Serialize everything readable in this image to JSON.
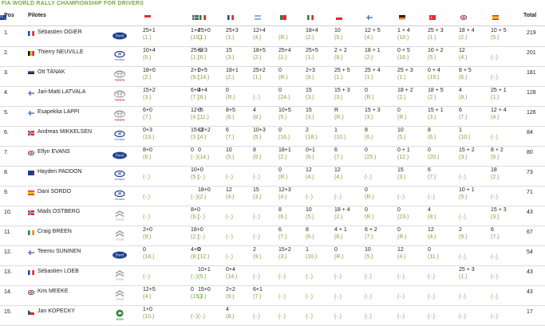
{
  "title": "FIA WORLD RALLY CHAMPIONSHIP FOR DRIVERS",
  "header": {
    "pos": "Pos",
    "pilotes": "Pilotes",
    "total": "Total"
  },
  "rally_flags": [
    {
      "flag": "monaco",
      "colors": [
        "#e8262c",
        "#ffffff"
      ]
    },
    {
      "flag": "sweden",
      "colors": [
        "#2f5ea8",
        "#f3c418"
      ]
    },
    {
      "flag": "mexico",
      "colors": [
        "#1b8a3c",
        "#ffffff",
        "#d52b1e"
      ]
    },
    {
      "flag": "france",
      "colors": [
        "#1e4ea0",
        "#ffffff",
        "#e8262c"
      ]
    },
    {
      "flag": "argentina",
      "colors": [
        "#7fb7e6",
        "#ffffff",
        "#7fb7e6"
      ]
    },
    {
      "flag": "portugal",
      "colors": [
        "#1b8a3c",
        "#e8262c"
      ]
    },
    {
      "flag": "italy",
      "colors": [
        "#1b8a3c",
        "#ffffff",
        "#e8262c"
      ]
    },
    {
      "flag": "poland",
      "colors": [
        "#ffffff",
        "#e8262c"
      ]
    },
    {
      "flag": "finland",
      "colors": [
        "#ffffff",
        "#2f5ea8"
      ]
    },
    {
      "flag": "germany",
      "colors": [
        "#111111",
        "#e8262c",
        "#f3c418"
      ]
    },
    {
      "flag": "turkey",
      "colors": [
        "#e8262c",
        "#ffffff"
      ]
    },
    {
      "flag": "great-britain",
      "colors": [
        "#1e3e8a",
        "#ffffff",
        "#e8262c"
      ]
    },
    {
      "flag": "spain",
      "colors": [
        "#e8262c",
        "#f3c418",
        "#e8262c"
      ]
    },
    {
      "flag": "australia",
      "colors": [
        "#1e3e8a",
        "#ffffff"
      ]
    }
  ],
  "drivers": [
    {
      "pos": "1.",
      "name": "Sébastien OGIER",
      "flag": "france",
      "team": "ford",
      "total": "219",
      "results": [
        [
          "25+1",
          "(1.)"
        ],
        [
          "1+4",
          "(10.)"
        ],
        [
          "25+0",
          "(1.)"
        ],
        [
          "25+3",
          "(1.)"
        ],
        [
          "12+4",
          "(4.)"
        ],
        [
          "",
          "(R.)"
        ],
        [
          "18+4",
          "(2.)"
        ],
        [
          "10",
          "(5.)"
        ],
        [
          "12 + 5",
          "(4.)"
        ],
        [
          "1 + 4",
          "(10.)"
        ],
        [
          "25 + 3",
          "(1.)"
        ],
        [
          "18 + 4",
          "(2.)"
        ],
        [
          "10 + 5",
          "(5.)"
        ],
        [
          "",
          ""
        ]
      ]
    },
    {
      "pos": "2.",
      "name": "Thierry NEUVILLE",
      "flag": "belgium",
      "team": "hyundai",
      "total": "201",
      "results": [
        [
          "10+4",
          "(5.)"
        ],
        [
          "25+2",
          "(1.)"
        ],
        [
          "8+3",
          "(6.)"
        ],
        [
          "15",
          "(3.)"
        ],
        [
          "18+5",
          "(2.)"
        ],
        [
          "25+4",
          "(1.)"
        ],
        [
          "25+5",
          "(1.)"
        ],
        [
          "2 + 2",
          "(9.)"
        ],
        [
          "18 + 1",
          "(2.)"
        ],
        [
          "0 + 5",
          "(16.)"
        ],
        [
          "10 + 2",
          "(5.)"
        ],
        [
          "12",
          "(4.)"
        ],
        [
          "",
          "(-.)"
        ],
        [
          "",
          ""
        ]
      ]
    },
    {
      "pos": "3.",
      "name": "Ott TÄNAK",
      "flag": "estonia",
      "team": "toyota",
      "total": "181",
      "results": [
        [
          "18+0",
          "(2.)"
        ],
        [
          "2+1",
          "(9.)"
        ],
        [
          "0+5",
          "(14.)"
        ],
        [
          "18+1",
          "(2.)"
        ],
        [
          "25+2",
          "(1.)"
        ],
        [
          "0",
          "(R.)"
        ],
        [
          "2+3",
          "(9.)"
        ],
        [
          "25 + 5",
          "(1.)"
        ],
        [
          "25 + 4",
          "(1.)"
        ],
        [
          "25 + 3",
          "(1.)"
        ],
        [
          "0 + 4",
          "(19.)"
        ],
        [
          "8 + 5",
          "(6.)"
        ],
        [
          "",
          "(-.)"
        ],
        [
          "",
          ""
        ]
      ]
    },
    {
      "pos": "4.",
      "name": "Jari-Matti LATVALA",
      "flag": "finland",
      "team": "toyota",
      "total": "128",
      "results": [
        [
          "15+2",
          "(3.)"
        ],
        [
          "6+0",
          "(7.)"
        ],
        [
          "4+4",
          "(8.)"
        ],
        [
          "0",
          "(R.)"
        ],
        [
          "",
          "(-.)"
        ],
        [
          "0",
          "(24.)"
        ],
        [
          "15",
          "(3.)"
        ],
        [
          "15 + 3",
          "(3.)"
        ],
        [
          "0",
          "(R.)"
        ],
        [
          "18 + 2",
          "(2.)"
        ],
        [
          "18 + 5",
          "(2.)"
        ],
        [
          "4",
          "(8.)"
        ],
        [
          "25 + 1",
          "(1.)"
        ],
        [
          "",
          ""
        ]
      ]
    },
    {
      "pos": "5.",
      "name": "Esapekka LAPPI",
      "flag": "finland",
      "team": "toyota",
      "total": "126",
      "results": [
        [
          "6+0",
          "(7.)"
        ],
        [
          "12+5",
          "(4.)"
        ],
        [
          "0",
          "(11.)"
        ],
        [
          "8+5",
          "(6.)"
        ],
        [
          "4",
          "(8.)"
        ],
        [
          "10+5",
          "(5.)"
        ],
        [
          "15",
          "(3.)"
        ],
        [
          "R",
          "(R.)"
        ],
        [
          "15 + 3",
          "(3.)"
        ],
        [
          "0",
          "(R.)"
        ],
        [
          "15 + 1",
          "(3.)"
        ],
        [
          "6",
          "(7.)"
        ],
        [
          "12 + 4",
          "(4.)"
        ],
        [
          "",
          ""
        ]
      ]
    },
    {
      "pos": "6.",
      "name": "Andreas MIKKELSEN",
      "flag": "norway",
      "team": "hyundai",
      "total": "84",
      "results": [
        [
          "0+3",
          "(13.)"
        ],
        [
          "15+3",
          "(3.)"
        ],
        [
          "12+2",
          "(4.)"
        ],
        [
          "6",
          "(7.)"
        ],
        [
          "10+3",
          "(5.)"
        ],
        [
          "0",
          "(16.)"
        ],
        [
          "2",
          "(18.)"
        ],
        [
          "1",
          "(10.)"
        ],
        [
          "8",
          "(6.)"
        ],
        [
          "10",
          "(5.)"
        ],
        [
          "8",
          "(6.)"
        ],
        [
          "1",
          "(10.)"
        ],
        [
          "",
          "(-.)"
        ],
        [
          "",
          ""
        ]
      ]
    },
    {
      "pos": "7.",
      "name": "Elfyn EVANS",
      "flag": "great-britain",
      "team": "ford",
      "total": "80",
      "results": [
        [
          "8+0",
          "(6.)"
        ],
        [
          "0",
          "(-.)"
        ],
        [
          "0",
          "(14.)"
        ],
        [
          "10",
          "(5.)"
        ],
        [
          "8",
          "(6.)"
        ],
        [
          "18+1",
          "(2.)"
        ],
        [
          "0+1",
          "(6.)"
        ],
        [
          "6",
          "(7.)"
        ],
        [
          "0",
          "(25.)"
        ],
        [
          "0 + 1",
          "(12.)"
        ],
        [
          "0",
          "(20.)"
        ],
        [
          "15 + 2",
          "(3.)"
        ],
        [
          "8 + 2",
          "(6.)"
        ],
        [
          "",
          ""
        ]
      ]
    },
    {
      "pos": "8.",
      "name": "Hayden PADDON",
      "flag": "new-zealand",
      "team": "hyundai",
      "total": "73",
      "results": [
        [
          "",
          "(-.)"
        ],
        [
          "10+0",
          "(5.)"
        ],
        [
          "",
          "(-.)"
        ],
        [
          "",
          "(-.)"
        ],
        [
          "",
          "(-.)"
        ],
        [
          "0",
          "(R.)"
        ],
        [
          "12",
          "(4.)"
        ],
        [
          "12",
          "(4.)"
        ],
        [
          "",
          "(-.)"
        ],
        [
          "15",
          "(3.)"
        ],
        [
          "6",
          "(7.)"
        ],
        [
          "",
          "(-.)"
        ],
        [
          "18",
          "(2.)"
        ],
        [
          "",
          ""
        ]
      ]
    },
    {
      "pos": "9.",
      "name": "Dani SORDO",
      "flag": "spain",
      "team": "hyundai",
      "total": "71",
      "results": [
        [
          "",
          "(-.)"
        ],
        [
          "",
          "(-.)"
        ],
        [
          "18+0",
          "(2.)"
        ],
        [
          "12",
          "(4.)"
        ],
        [
          "15",
          "(3.)"
        ],
        [
          "12+3",
          "(4.)"
        ],
        [
          "",
          "(-.)"
        ],
        [
          "",
          "(-.)"
        ],
        [
          "0",
          "(R.)"
        ],
        [
          "",
          "(-.)"
        ],
        [
          "",
          "(-.)"
        ],
        [
          "10 + 1",
          "(5.)"
        ],
        [
          "",
          "(-.)"
        ],
        [
          "",
          ""
        ]
      ]
    },
    {
      "pos": "10.",
      "name": "Mads OSTBERG",
      "flag": "norway",
      "team": "citroen",
      "total": "43",
      "results": [
        [
          "",
          "(-.)"
        ],
        [
          "8+0",
          "(6.)"
        ],
        [
          "",
          "(-.)"
        ],
        [
          "",
          "(-.)"
        ],
        [
          "",
          "(-.)"
        ],
        [
          "8",
          "(6.)"
        ],
        [
          "10",
          "(5.)"
        ],
        [
          "18 + 4",
          "(2.)"
        ],
        [
          "0",
          "(R.)"
        ],
        [
          "0",
          "(23.)"
        ],
        [
          "4",
          "(8.)"
        ],
        [
          "",
          "(-.)"
        ],
        [
          "15 + 3",
          "(3.)"
        ],
        [
          "",
          ""
        ]
      ]
    },
    {
      "pos": "11.",
      "name": "Craig BREEN",
      "flag": "ireland",
      "team": "citroen",
      "total": "67",
      "results": [
        [
          "2+0",
          "(9.)"
        ],
        [
          "18+0",
          "(2.)"
        ],
        [
          "",
          "(-.)"
        ],
        [
          "",
          "(-.)"
        ],
        [
          "",
          "(-.)"
        ],
        [
          "6",
          "(7.)"
        ],
        [
          "8",
          "(6.)"
        ],
        [
          "4 + 1",
          "(8.)"
        ],
        [
          "6 + 2",
          "(7.)"
        ],
        [
          "0",
          "(R.)"
        ],
        [
          "12",
          "(4.)"
        ],
        [
          "2",
          "(9.)"
        ],
        [
          "6",
          "(7.)"
        ],
        [
          "",
          ""
        ]
      ]
    },
    {
      "pos": "12.",
      "name": "Teemu SUNINEN",
      "flag": "finland",
      "team": "ford",
      "total": "54",
      "results": [
        [
          "0",
          "(18.)"
        ],
        [
          "4+0",
          "(8.)"
        ],
        [
          "0",
          "(12.)"
        ],
        [
          "",
          "(-.)"
        ],
        [
          "2",
          "(9.)"
        ],
        [
          "15+2",
          "(3.)"
        ],
        [
          "1",
          "(10.)"
        ],
        [
          "0",
          "(R.)"
        ],
        [
          "10",
          "(5.)"
        ],
        [
          "12",
          "(4.)"
        ],
        [
          "0",
          "(11.)"
        ],
        [
          "",
          "(-.)"
        ],
        [
          "",
          "(-.)"
        ],
        [
          "",
          ""
        ]
      ]
    },
    {
      "pos": "13.",
      "name": "Sébastien LOEB",
      "flag": "france",
      "team": "citroen",
      "total": "43",
      "results": [
        [
          "",
          "(-.)"
        ],
        [
          "",
          "(-.)"
        ],
        [
          "10+1",
          "(5.)"
        ],
        [
          "0+4",
          "(14.)"
        ],
        [
          "",
          "(-.)"
        ],
        [
          "",
          "(-.)"
        ],
        [
          "",
          "(-.)"
        ],
        [
          "",
          "(-.)"
        ],
        [
          "",
          "(-.)"
        ],
        [
          "",
          "(-.)"
        ],
        [
          "",
          "(-.)"
        ],
        [
          "25 + 3",
          "(1.)"
        ],
        [
          "",
          "(-.)"
        ],
        [
          "",
          ""
        ]
      ]
    },
    {
      "pos": "14.",
      "name": "Kris MEEKE",
      "flag": "great-britain",
      "team": "citroen",
      "total": "43",
      "results": [
        [
          "12+5",
          "(4.)"
        ],
        [
          "0",
          "(15.)"
        ],
        [
          "15+0",
          "(3.)"
        ],
        [
          "2+2",
          "(9.)"
        ],
        [
          "6+1",
          "(7.)"
        ],
        [
          "",
          "(-.)"
        ],
        [
          "",
          "(-.)"
        ],
        [
          "",
          "(-.)"
        ],
        [
          "",
          "(-.)"
        ],
        [
          "",
          "(-.)"
        ],
        [
          "",
          "(-.)"
        ],
        [
          "",
          "(-.)"
        ],
        [
          "",
          "(-.)"
        ],
        [
          "",
          ""
        ]
      ]
    },
    {
      "pos": "15.",
      "name": "Jan KOPECKY",
      "flag": "czech",
      "team": "skoda",
      "total": "17",
      "results": [
        [
          "1+0",
          "(10.)"
        ],
        [
          "",
          "(-.)"
        ],
        [
          "",
          "(-.)"
        ],
        [
          "4",
          "(8.)"
        ],
        [
          "",
          "(-.)"
        ],
        [
          "",
          "(-.)"
        ],
        [
          "",
          "(-.)"
        ],
        [
          "",
          "(-.)"
        ],
        [
          "",
          "(-.)"
        ],
        [
          "",
          "(-.)"
        ],
        [
          "",
          "(-.)"
        ],
        [
          "",
          "(-.)"
        ],
        [
          "",
          "(-.)"
        ],
        [
          "",
          ""
        ]
      ]
    }
  ]
}
